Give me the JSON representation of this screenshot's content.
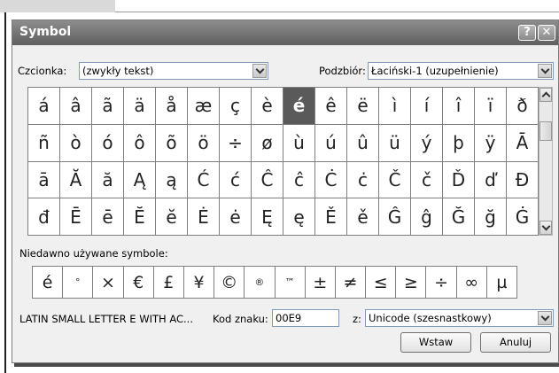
{
  "dialog": {
    "title": "Symbol",
    "help_glyph": "?",
    "close_glyph": "✕"
  },
  "font": {
    "label": "Czcionka:",
    "value": "(zwykły tekst)"
  },
  "subset": {
    "label": "Podzbiór:",
    "value": "Łaciński-1 (uzupełnienie)"
  },
  "symbols": [
    [
      "á",
      "â",
      "ã",
      "ä",
      "å",
      "æ",
      "ç",
      "è",
      "é",
      "ê",
      "ë",
      "ì",
      "í",
      "î",
      "ï",
      "ð"
    ],
    [
      "ñ",
      "ò",
      "ó",
      "ô",
      "õ",
      "ö",
      "÷",
      "ø",
      "ù",
      "ú",
      "û",
      "ü",
      "ý",
      "þ",
      "ÿ",
      "Ā"
    ],
    [
      "ā",
      "Ă",
      "ă",
      "Ą",
      "ą",
      "Ć",
      "ć",
      "Ĉ",
      "ĉ",
      "Ċ",
      "ċ",
      "Č",
      "č",
      "Ď",
      "ď",
      "Đ"
    ],
    [
      "đ",
      "Ē",
      "ē",
      "Ĕ",
      "ĕ",
      "Ė",
      "ė",
      "Ę",
      "ę",
      "Ě",
      "ě",
      "Ĝ",
      "ĝ",
      "Ğ",
      "ğ",
      "Ġ"
    ]
  ],
  "selected_symbol": "é",
  "recent": {
    "label": "Niedawno używane symbole:",
    "items": [
      "é",
      "°",
      "×",
      "€",
      "£",
      "¥",
      "©",
      "®",
      "™",
      "±",
      "≠",
      "≤",
      "≥",
      "÷",
      "∞",
      "µ"
    ]
  },
  "char_name": "LATIN SMALL LETTER E WITH AC...",
  "char_code": {
    "label": "Kod znaku:",
    "value": "00E9"
  },
  "from": {
    "label": "z:",
    "value": "Unicode (szesnastkowy)"
  },
  "buttons": {
    "insert": "Wstaw",
    "cancel": "Anuluj"
  },
  "icons": {
    "combo_arrow": "chevron-down-icon",
    "scroll_up": "chevron-up-icon",
    "scroll_down": "chevron-down-icon"
  }
}
